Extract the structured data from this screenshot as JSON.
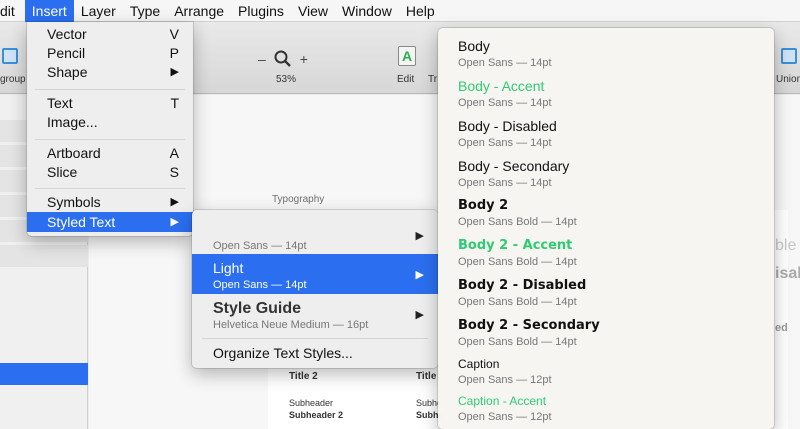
{
  "menubar": {
    "items": [
      {
        "label": "dit",
        "active": false
      },
      {
        "label": "Insert",
        "active": true
      },
      {
        "label": "Layer",
        "active": false
      },
      {
        "label": "Type",
        "active": false
      },
      {
        "label": "Arrange",
        "active": false
      },
      {
        "label": "Plugins",
        "active": false
      },
      {
        "label": "View",
        "active": false
      },
      {
        "label": "Window",
        "active": false
      },
      {
        "label": "Help",
        "active": false
      }
    ]
  },
  "toolbar": {
    "group_label": "group",
    "zoom_minus": "–",
    "zoom_plus": "+",
    "zoom_value": "53%",
    "edit_label": "Edit",
    "edit_icon_glyph": "A",
    "transform_label": "Tr",
    "union_label": "Union"
  },
  "insert_menu": {
    "items": [
      {
        "label": "Vector",
        "shortcut": "V"
      },
      {
        "label": "Pencil",
        "shortcut": "P"
      },
      {
        "label": "Shape",
        "submenu": "▶"
      },
      {
        "label": "Text",
        "shortcut": "T"
      },
      {
        "label": "Image..."
      },
      {
        "label": "Artboard",
        "shortcut": "A"
      },
      {
        "label": "Slice",
        "shortcut": "S"
      },
      {
        "label": "Symbols",
        "submenu": "▶"
      },
      {
        "label": "Styled Text",
        "submenu": "▶"
      }
    ]
  },
  "styled_text_menu": {
    "dark_desc": "Open Sans — 14pt",
    "light_label": "Light",
    "light_desc": "Open Sans — 14pt",
    "style_guide_label": "Style Guide",
    "style_guide_desc": "Helvetica Neue Medium — 16pt",
    "organize_label": "Organize Text Styles...",
    "arrow": "▶"
  },
  "styles_menu": {
    "items": [
      {
        "name": "Body",
        "desc": "Open Sans — 14pt"
      },
      {
        "name": "Body - Accent",
        "desc": "Open Sans — 14pt"
      },
      {
        "name": "Body - Disabled",
        "desc": "Open Sans — 14pt"
      },
      {
        "name": "Body - Secondary",
        "desc": "Open Sans — 14pt"
      },
      {
        "name": "Body 2",
        "desc": "Open Sans Bold — 14pt"
      },
      {
        "name": "Body 2 - Accent",
        "desc": "Open Sans Bold — 14pt"
      },
      {
        "name": "Body 2 - Disabled",
        "desc": "Open Sans Bold — 14pt"
      },
      {
        "name": "Body 2 - Secondary",
        "desc": "Open Sans Bold — 14pt"
      },
      {
        "name": "Caption",
        "desc": "Open Sans — 12pt"
      },
      {
        "name": "Caption - Accent",
        "desc": "Open Sans — 12pt"
      }
    ]
  },
  "canvas": {
    "artboard_title": "Typography",
    "title2_a": "Title 2",
    "title2_b": "Title",
    "subheader_a": "Subheader",
    "subheader2_a": "Subheader 2",
    "subheader_b": "Subhe",
    "subheader2_b": "Subhe",
    "ghost_1": "ble",
    "ghost_2": "isal",
    "ghost_3": "ed"
  },
  "colors": {
    "highlight": "#2b6ff0",
    "accent_green": "#2ecc71"
  }
}
